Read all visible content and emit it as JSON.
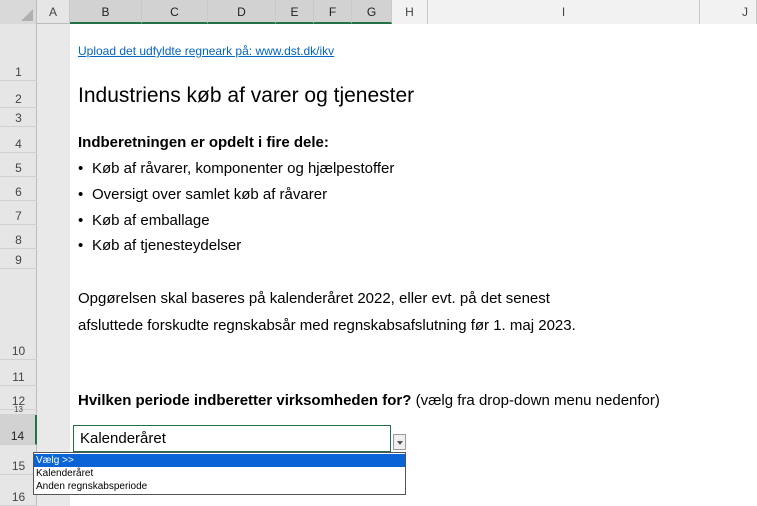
{
  "columns": [
    "A",
    "B",
    "C",
    "D",
    "E",
    "F",
    "G",
    "H",
    "I",
    "J"
  ],
  "rows": [
    "1",
    "2",
    "3",
    "4",
    "5",
    "6",
    "7",
    "8",
    "9",
    "10",
    "11",
    "12",
    "13",
    "14",
    "15",
    "16"
  ],
  "content": {
    "upload_link": "Upload det udfyldte regneark på: www.dst.dk/ikv",
    "title": "Industriens køb af varer og tjenester",
    "intro_heading": "Indberetningen er opdelt i fire dele:",
    "bullets": [
      "Køb af råvarer, komponenter og hjælpestoffer",
      "Oversigt over samlet køb af råvarer",
      "Køb af emballage",
      "Køb af tjenesteydelser"
    ],
    "bullet_char": "•",
    "paragraph_line1": "Opgørelsen skal baseres på kalenderåret 2022, eller evt. på det senest",
    "paragraph_line2": "afsluttede forskudte regnskabsår med regnskabsafslutning før 1. maj 2023.",
    "question_bold": "Hvilken periode indberetter virksomheden for?",
    "question_hint": "(vælg fra drop-down menu nedenfor)"
  },
  "dropdown": {
    "selected_value": "Kalenderåret",
    "options": [
      "Vælg >>",
      "Kalenderåret",
      "Anden regnskabsperiode"
    ]
  },
  "colors": {
    "link": "#0563c1",
    "selection_green": "#217346",
    "highlight_blue": "#0a64d6"
  }
}
